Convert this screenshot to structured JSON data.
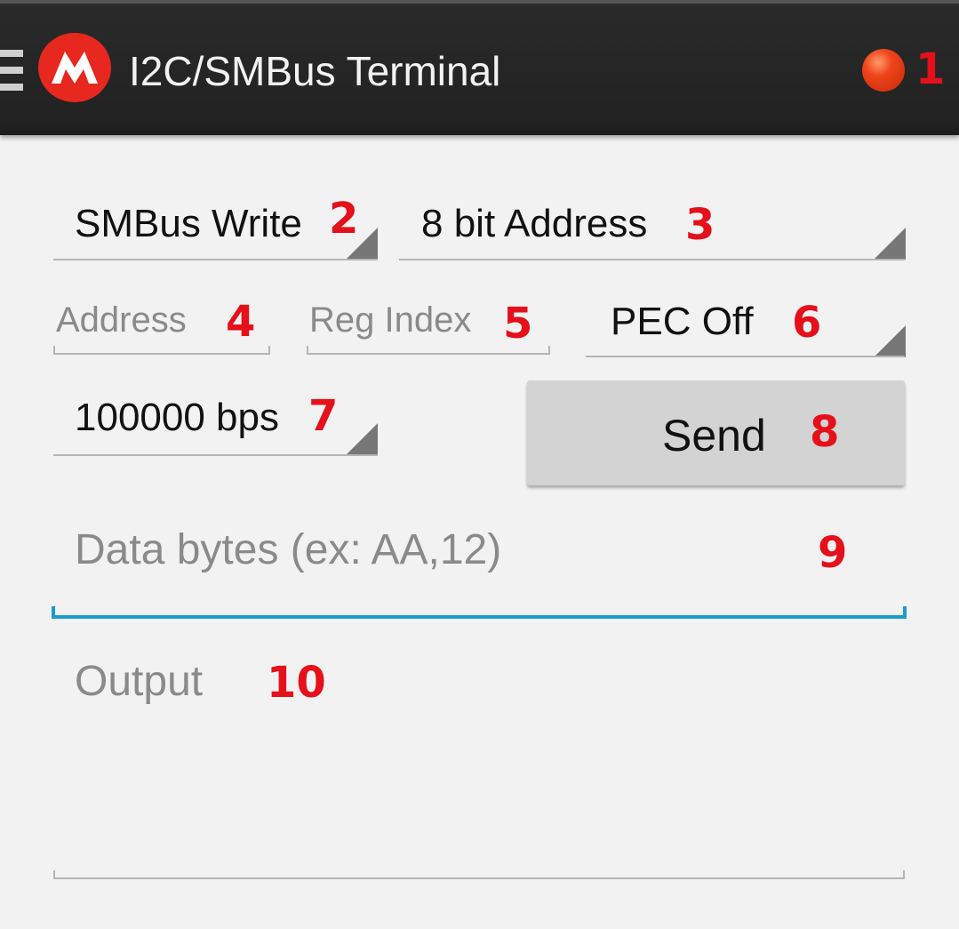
{
  "app_bar": {
    "title": "I2C/SMBus Terminal",
    "status_color": "#f0441a",
    "callout": "1"
  },
  "controls": {
    "mode": {
      "value": "SMBus Write",
      "callout": "2"
    },
    "address_mode": {
      "value": "8 bit Address",
      "callout": "3"
    },
    "address": {
      "placeholder": "Address",
      "callout": "4"
    },
    "reg_index": {
      "placeholder": "Reg Index",
      "callout": "5"
    },
    "pec": {
      "value": "PEC Off",
      "callout": "6"
    },
    "bitrate": {
      "value": "100000 bps",
      "callout": "7"
    },
    "send": {
      "label": "Send",
      "callout": "8"
    },
    "data_bytes": {
      "placeholder": "Data bytes (ex: AA,12)",
      "callout": "9"
    },
    "output": {
      "placeholder": "Output",
      "callout": "10"
    }
  },
  "colors": {
    "accent": "#1a9bd0",
    "callout": "#e5101a",
    "toolbar": "#232323"
  }
}
